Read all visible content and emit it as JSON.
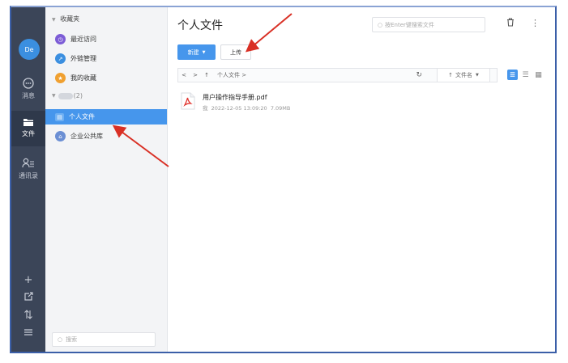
{
  "rail": {
    "avatar": "De",
    "items": [
      {
        "label": "消息",
        "icon": "chat-icon"
      },
      {
        "label": "文件",
        "icon": "folder-icon"
      },
      {
        "label": "通讯录",
        "icon": "contacts-icon"
      }
    ],
    "bottom_icons": [
      "plus-icon",
      "export-icon",
      "sort-icon",
      "menu-icon"
    ]
  },
  "sidebar": {
    "favorites_header": "收藏夹",
    "favorites": [
      {
        "label": "最近访问",
        "color": "#7c5cd6",
        "icon": "clock-icon"
      },
      {
        "label": "外链管理",
        "color": "#3b8fe0",
        "icon": "link-icon"
      },
      {
        "label": "我的收藏",
        "color": "#f0a030",
        "icon": "star-icon"
      }
    ],
    "group_header": "(2)",
    "items": [
      {
        "label": "个人文件",
        "active": true,
        "color": "#4696ec",
        "icon": "person-folder-icon"
      },
      {
        "label": "企业公共库",
        "active": false,
        "color": "#6b8fd4",
        "icon": "enterprise-library-icon"
      }
    ],
    "search_placeholder": "搜索"
  },
  "main": {
    "title": "个人文件",
    "search_placeholder": "按Enter键搜索文件",
    "new_button": "新建",
    "upload_button": "上传",
    "breadcrumb": "个人文件 >",
    "sort_label": "文件名",
    "files": [
      {
        "name": "用户操作指导手册.pdf",
        "owner": "我",
        "modified": "2022-12-05 13:09:20",
        "size": "7.09MB"
      }
    ]
  },
  "colors": {
    "accent": "#4696ec",
    "rail": "#3b4558",
    "annotation": "#d93025"
  }
}
